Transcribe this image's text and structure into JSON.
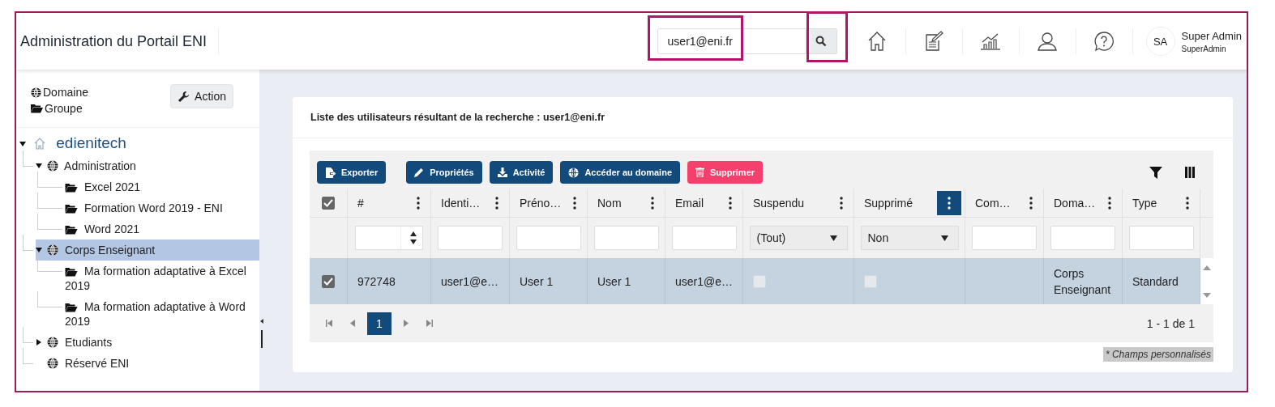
{
  "header": {
    "title": "Administration du Portail ENI",
    "search": {
      "value": "user1@eni.fr",
      "highlighted": true
    },
    "search_button": {
      "highlighted": true
    },
    "nav": [
      {
        "kind": "home"
      },
      {
        "kind": "edit"
      },
      {
        "kind": "chart"
      },
      {
        "kind": "user"
      },
      {
        "kind": "help"
      }
    ],
    "user": {
      "initials": "SA",
      "name": "Super Admin",
      "login": "SuperAdmin"
    }
  },
  "sidebar": {
    "legend": [
      {
        "kind": "domain",
        "label": "Domaine"
      },
      {
        "kind": "group",
        "label": "Groupe"
      }
    ],
    "action_button": "Action",
    "tree": [
      {
        "kind": "root",
        "label": "edienitech",
        "expanded": true,
        "selected": false,
        "children": [
          {
            "kind": "domain",
            "label": "Administration",
            "expanded": true,
            "selected": false,
            "children": [
              {
                "kind": "group",
                "label": "Excel 2021",
                "selected": false
              },
              {
                "kind": "group",
                "label": "Formation Word 2019 - ENI",
                "selected": false
              },
              {
                "kind": "group",
                "label": "Word 2021",
                "selected": false
              }
            ]
          },
          {
            "kind": "domain",
            "label": "Corps Enseignant",
            "expanded": true,
            "selected": true,
            "children": [
              {
                "kind": "group",
                "label": "Ma formation adaptative à Excel 2019",
                "selected": false
              },
              {
                "kind": "group",
                "label": "Ma formation adaptative à Word 2019",
                "selected": false
              }
            ]
          },
          {
            "kind": "domain",
            "label": "Etudiants",
            "expanded": false,
            "selected": false
          },
          {
            "kind": "domain",
            "label": "Réservé ENI",
            "selected": false
          }
        ]
      }
    ]
  },
  "card": {
    "title": "Liste des utilisateurs résultant de la recherche : user1@eni.fr",
    "toolbar": [
      {
        "kind": "export",
        "label": "Exporter"
      },
      {
        "kind": "edit",
        "label": "Propriétés"
      },
      {
        "kind": "download",
        "label": "Activité"
      },
      {
        "kind": "globe",
        "label": "Accéder au domaine"
      },
      {
        "kind": "delete",
        "label": "Supprimer"
      }
    ],
    "select_all_checked": true,
    "columns": [
      {
        "label": "#",
        "menu_active": false,
        "filter": {
          "kind": "number"
        }
      },
      {
        "label": "Identi…",
        "menu_active": false,
        "filter": {
          "kind": "text"
        }
      },
      {
        "label": "Préno…",
        "menu_active": false,
        "filter": {
          "kind": "text"
        }
      },
      {
        "label": "Nom",
        "menu_active": false,
        "filter": {
          "kind": "text"
        }
      },
      {
        "label": "Email",
        "menu_active": false,
        "filter": {
          "kind": "text"
        }
      },
      {
        "label": "Suspendu",
        "menu_active": false,
        "filter": {
          "kind": "select",
          "value": "(Tout)"
        }
      },
      {
        "label": "Supprimé",
        "menu_active": true,
        "filter": {
          "kind": "select",
          "value": "Non"
        }
      },
      {
        "label": "Com…",
        "menu_active": false,
        "filter": {
          "kind": "text"
        }
      },
      {
        "label": "Doma…",
        "menu_active": false,
        "filter": {
          "kind": "text"
        }
      },
      {
        "label": "Type",
        "menu_active": false,
        "filter": {
          "kind": "text"
        }
      }
    ],
    "rows": [
      {
        "selected": true,
        "cells": [
          {
            "kind": "text",
            "text": "972748"
          },
          {
            "kind": "text",
            "text": "user1@e…"
          },
          {
            "kind": "text",
            "text": "User 1"
          },
          {
            "kind": "text",
            "text": "User 1"
          },
          {
            "kind": "text",
            "text": "user1@e…"
          },
          {
            "kind": "check",
            "checked": false
          },
          {
            "kind": "check",
            "checked": false
          },
          {
            "kind": "blank"
          },
          {
            "kind": "text",
            "text": "Corps Enseignant"
          },
          {
            "kind": "text",
            "text": "Standard"
          }
        ]
      }
    ],
    "pager": {
      "pages": [
        {
          "label": "1",
          "selected": true
        }
      ],
      "summary": "1 - 1 de 1"
    },
    "footnote": "* Champs personnalisés"
  }
}
